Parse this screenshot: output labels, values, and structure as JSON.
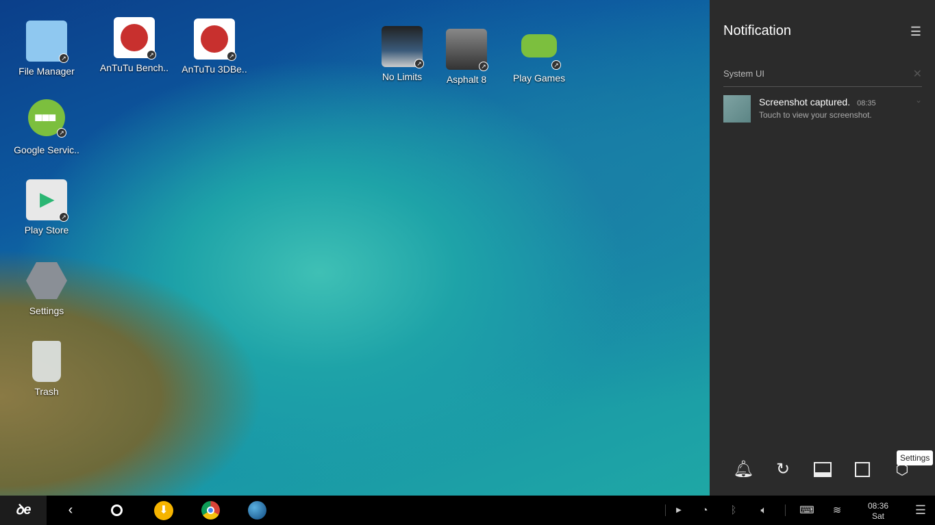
{
  "desktop": {
    "icons": [
      {
        "label": "File Manager",
        "color": "#8fc8f0"
      },
      {
        "label": "AnTuTu Bench..",
        "color": "#c8302e"
      },
      {
        "label": "AnTuTu 3DBe..",
        "color": "#c8302e"
      },
      {
        "label": "No Limits",
        "color": "#3a5a7a"
      },
      {
        "label": "Asphalt 8",
        "color": "#555555"
      },
      {
        "label": "Play Games",
        "color": "#7cbf3e"
      },
      {
        "label": "Google Servic..",
        "color": "#7cbf3e"
      },
      {
        "label": "Play Store",
        "color": "#e8e8e8"
      },
      {
        "label": "Settings",
        "color": "#8a8f96"
      },
      {
        "label": "Trash",
        "color": "#dfe6ea"
      }
    ]
  },
  "notification_panel": {
    "title": "Notification",
    "group": "System UI",
    "notification": {
      "title": "Screenshot captured.",
      "time": "08:35",
      "text": "Touch to view your screenshot."
    },
    "quick_settings": [
      "bell-icon",
      "rotate-icon",
      "window-icon",
      "screenshot-crop-icon",
      "settings-icon"
    ],
    "tooltip": "Settings"
  },
  "taskbar": {
    "time": "08:36",
    "day": "Sat"
  }
}
